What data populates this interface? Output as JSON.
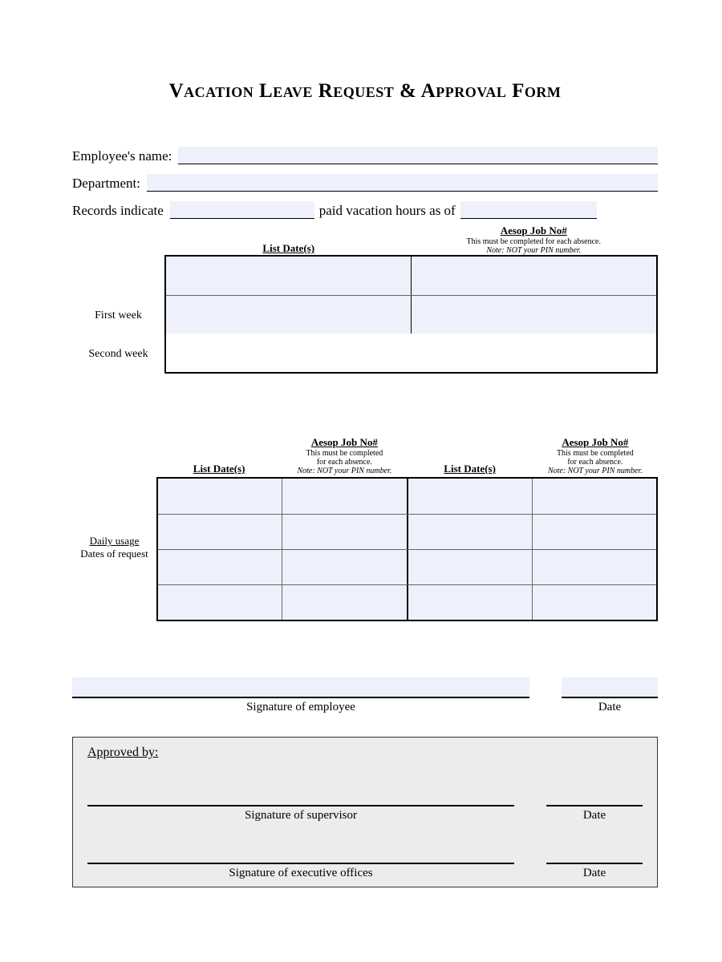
{
  "title": "Vacation Leave Request & Approval Form",
  "fields": {
    "employee_name_label": "Employee's name:",
    "department_label": "Department:",
    "records_indicate_label": "Records indicate",
    "paid_hours_label": "paid vacation hours as of"
  },
  "week_table": {
    "col1": "List Date(s)",
    "col2_title": "Aesop Job No#",
    "col2_line1": "This must be completed for each absence.",
    "col2_line2": "Note: NOT your PIN number.",
    "row1": "First week",
    "row2": "Second week"
  },
  "daily_table": {
    "side_line1": "Daily usage",
    "side_line2": "Dates of request",
    "col_date": "List Date(s)",
    "col_job_title": "Aesop Job No#",
    "col_job_line1": "This must be completed",
    "col_job_line2": "for each absence.",
    "col_job_line3": "Note: NOT your PIN number."
  },
  "signatures": {
    "employee": "Signature of employee",
    "date": "Date",
    "approved_by": "Approved by:",
    "supervisor": "Signature of supervisor",
    "executive": "Signature of executive offices"
  }
}
